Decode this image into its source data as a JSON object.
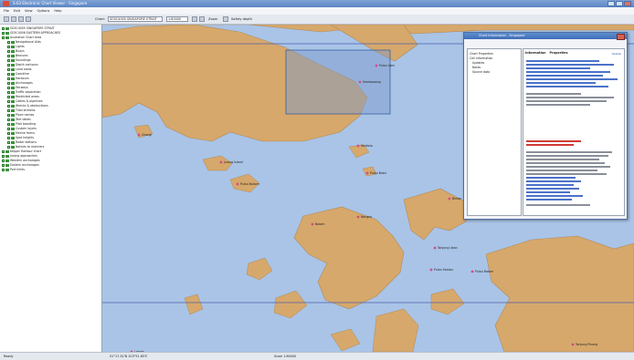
{
  "app": {
    "title": "S-63 Electronic Chart Viewer - Singapore",
    "menu": [
      "File",
      "Edit",
      "View",
      "Options",
      "Help"
    ],
    "toolbar": {
      "chart_label": "Chart:",
      "chart_value": "SG5C4005 SINGAPORE STRAIT",
      "scale_value": "1:80000",
      "zoom_text": "Zoom",
      "safety_text": "Safety depth"
    }
  },
  "tree": {
    "items": [
      "SG5C4005 SINGAPORE STRAIT",
      "SG5C4006 EASTERN APPROACHES",
      "Australian Chart Area",
      "Navigational Aids",
      "Lights",
      "Buoys",
      "Beacons",
      "Soundings",
      "Depth contours",
      "Land areas",
      "Coastline",
      "Harbours",
      "Anchorages",
      "Fairways",
      "Traffic separation",
      "Restricted areas",
      "Cables & pipelines",
      "Wrecks & obstructions",
      "Tidal streams",
      "Place names",
      "Text labels",
      "Pilot boarding",
      "Custom layers",
      "Marine farms",
      "Spot heights",
      "Radar stations",
      "Notices to mariners",
      "Keppel Harbour chart",
      "Jurong approaches",
      "Western anchorages",
      "Eastern anchorages",
      "Port limits"
    ]
  },
  "map": {
    "labels": [
      "Pulau Ubin",
      "Sembawang",
      "Changi",
      "Jurong Island",
      "Pulau Bukom",
      "Sentosa",
      "Pulau Brani",
      "Batam",
      "Nongsa",
      "Bintan",
      "Tanjung Uban",
      "Pulau Sambu",
      "Pulau Batam",
      "Tanjung Pinang",
      "Lobam"
    ]
  },
  "dialog": {
    "title": "Chart Information - Singapore",
    "tree_items": [
      "Chart Properties",
      "Cell Information",
      "Updates",
      "Notes",
      "Source data"
    ],
    "tabs": [
      "Information",
      "Properties"
    ],
    "link_label": "Details"
  },
  "status": {
    "left": "Ready",
    "coords": "01°17.32'N 103°51.85'E",
    "scale": "Scale 1:80000"
  }
}
